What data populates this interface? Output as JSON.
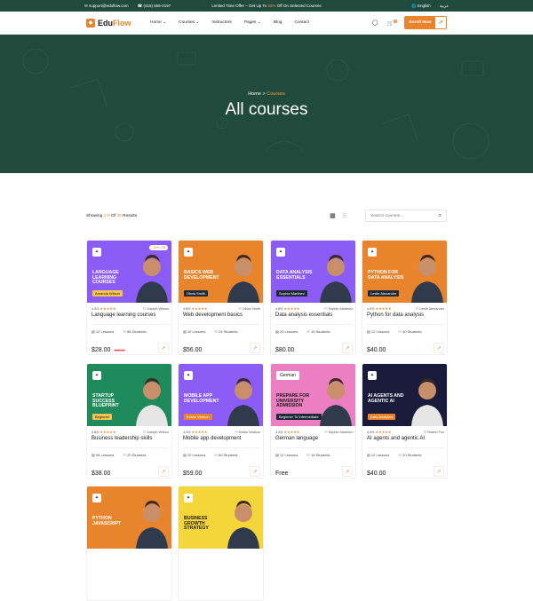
{
  "topbar": {
    "email": "support@eduflow.com",
    "phone": "(415) 555-0197",
    "offer_prefix": "Limited Time Offer – Get Up To",
    "offer_percent": "25%",
    "offer_suffix": "Off On Selected Courses",
    "language": "English",
    "language_alt": "عربية"
  },
  "nav": {
    "logo_prefix": "Edu",
    "logo_suffix": "Flow",
    "items": [
      "Home",
      "Courses",
      "Instructors",
      "Pages",
      "Blog",
      "Contact"
    ],
    "cart_count": "0",
    "enroll_label": "Enroll Now"
  },
  "hero": {
    "breadcrumb_home": "Home",
    "breadcrumb_sep": ">",
    "breadcrumb_current": "Courses",
    "title": "All courses"
  },
  "toolbar": {
    "showing_prefix": "Showing",
    "range": "1-8",
    "of_word": "Of",
    "total": "36",
    "results_word": "Results",
    "search_placeholder": "Search courses..."
  },
  "colors": {
    "brand": "#1f4a3c",
    "accent": "#e8842c"
  },
  "courses": [
    {
      "thumb_title": "Language Learning Courses",
      "tag": "Amanda Wilson",
      "tag_color": "#f6c453",
      "bg": "#8b5cf6",
      "discount": "-20% Off",
      "rating": "4.9/5",
      "instructor": "Joseph Wilson",
      "title": "Language learning courses",
      "lessons": "12 Lessons",
      "students": "86 Students",
      "price": "$28.00",
      "old_price": "$35.00"
    },
    {
      "thumb_title": "Basics Web Development",
      "tag": "Olivia Smith",
      "tag_color": "#1f2937",
      "bg": "#e8842c",
      "discount": "",
      "rating": "4.8/5",
      "instructor": "Olivia Smith",
      "title": "Web development basics",
      "lessons": "10 Lessons",
      "students": "24 Students",
      "price": "$56.00",
      "old_price": ""
    },
    {
      "thumb_title": "Data Analysis Essentials",
      "tag": "Sophia Martinez",
      "tag_color": "#1f2937",
      "bg": "#8b5cf6",
      "discount": "",
      "rating": "4.8/5",
      "instructor": "Sophie Martinez",
      "title": "Data analysis essentials",
      "lessons": "20 Lessons",
      "students": "15 Students",
      "price": "$80.00",
      "old_price": ""
    },
    {
      "thumb_title": "Python for Data Analysis",
      "tag": "Leslie Alexander",
      "tag_color": "#1f2937",
      "bg": "#e8842c",
      "discount": "",
      "rating": "4.9/5",
      "instructor": "Leslie Alexander",
      "title": "Python for data analysis",
      "lessons": "12 Lessons",
      "students": "40 Students",
      "price": "$40.00",
      "old_price": ""
    },
    {
      "thumb_title": "Startup Success Blueprint",
      "tag": "Beginner",
      "tag_color": "#f6c453",
      "bg": "#1f8a5b",
      "discount": "",
      "rating": "4.8/5",
      "instructor": "Joseph Wilson",
      "title": "Business leadership skills",
      "lessons": "06 Lessons",
      "students": "20 Students",
      "price": "$38.00",
      "old_price": ""
    },
    {
      "thumb_title": "Mobile App Development",
      "tag": "Kristin Watson",
      "tag_color": "#e8842c",
      "bg": "#8b5cf6",
      "discount": "",
      "rating": "4.9/5",
      "instructor": "Kristin Watson",
      "title": "Mobile app development",
      "lessons": "10 Lessons",
      "students": "66 Students",
      "price": "$59.00",
      "old_price": ""
    },
    {
      "thumb_title": "Prepare for University Admission",
      "tag": "Beginner To Intermediate",
      "tag_color": "#1f2937",
      "bg": "#ec7fc1",
      "discount": "",
      "rating": "4.9/5",
      "instructor": "Sophie Martinez",
      "title": "German language",
      "lessons": "12 Lessons",
      "students": "16 Students",
      "price": "Free",
      "old_price": ""
    },
    {
      "thumb_title": "AI Agents and Agentic AI",
      "tag": "Data Analytics",
      "tag_color": "#e8842c",
      "bg": "#1a1b3a",
      "discount": "",
      "rating": "4.9/5",
      "instructor": "Robert Fox",
      "title": "AI agents and agentic AI",
      "lessons": "12 Lessons",
      "students": "20 Students",
      "price": "$40.00",
      "old_price": ""
    },
    {
      "thumb_title": "Python JavaScript",
      "tag": "",
      "tag_color": "",
      "bg": "#e8842c",
      "discount": "",
      "rating": "",
      "instructor": "",
      "title": "",
      "lessons": "",
      "students": "",
      "price": "",
      "old_price": ""
    },
    {
      "thumb_title": "Business Growth Strategy",
      "tag": "",
      "tag_color": "",
      "bg": "#f5d63a",
      "discount": "",
      "rating": "",
      "instructor": "",
      "title": "",
      "lessons": "",
      "students": "",
      "price": "",
      "old_price": ""
    }
  ],
  "course_extra": {
    "german_label": "German"
  }
}
